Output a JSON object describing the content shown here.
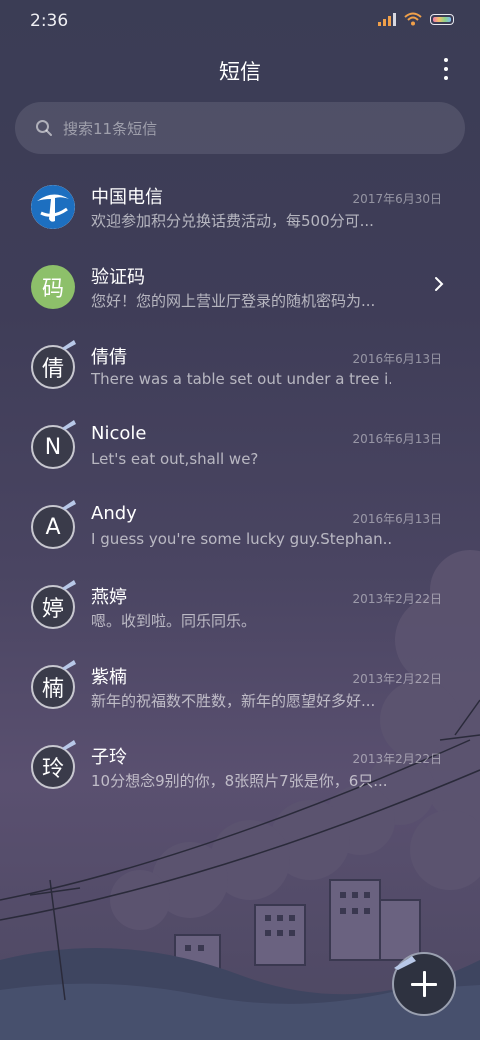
{
  "status_bar": {
    "time": "2:36"
  },
  "header": {
    "title": "短信"
  },
  "search": {
    "placeholder": "搜索11条短信"
  },
  "conversations": [
    {
      "name": "中国电信",
      "date": "2017年6月30日",
      "preview": "欢迎参加积分兑换话费活动，每500分可...",
      "avatar": "china-telecom-logo"
    },
    {
      "name": "验证码",
      "date": "",
      "preview": "您好！您的网上营业厅登录的随机密码为...",
      "avatar": "码"
    },
    {
      "name": "倩倩",
      "date": "2016年6月13日",
      "preview": "There was a table set out under a tree i...",
      "avatar": "倩"
    },
    {
      "name": "Nicole",
      "date": "2016年6月13日",
      "preview": "Let's eat out,shall we?",
      "avatar": "N"
    },
    {
      "name": "Andy",
      "date": "2016年6月13日",
      "preview": "I guess you're some lucky guy.Stephan...",
      "avatar": "A"
    },
    {
      "name": "燕婷",
      "date": "2013年2月22日",
      "preview": "嗯。收到啦。同乐同乐。",
      "avatar": "婷"
    },
    {
      "name": "紫楠",
      "date": "2013年2月22日",
      "preview": "新年的祝福数不胜数，新年的愿望好多好...",
      "avatar": "楠"
    },
    {
      "name": "子玲",
      "date": "2013年2月22日",
      "preview": "10分想念9别的你，8张照片7张是你，6只...",
      "avatar": "玲"
    }
  ],
  "colors": {
    "green_avatar": "#8dc06a",
    "telecom_blue": "#1d6fc0"
  }
}
